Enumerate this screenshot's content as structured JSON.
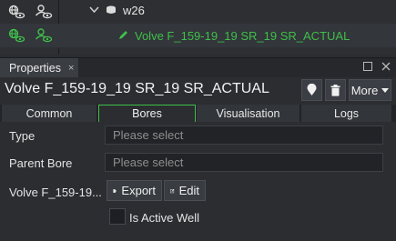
{
  "colors": {
    "accent_green": "#3fbf4a",
    "background": "#2b2d31"
  },
  "tree": {
    "node1": {
      "label": "w26",
      "icon": "database-icon",
      "expander": "chevron-down-icon"
    },
    "node2": {
      "label": "Volve F_159-19_19 SR_19 SR_ACTUAL",
      "icon": "pencil-icon"
    },
    "row_icons": [
      "globe-eye-icon",
      "user-eye-icon"
    ]
  },
  "panel": {
    "tab_label": "Properties",
    "tab_close": "×",
    "title": "Volve F_159-19_19 SR_19 SR_ACTUAL",
    "buttons": {
      "more_label": "More"
    }
  },
  "subtabs": [
    {
      "label": "Common",
      "active": false
    },
    {
      "label": "Bores",
      "active": true
    },
    {
      "label": "Visualisation",
      "active": false
    },
    {
      "label": "Logs",
      "active": false
    }
  ],
  "form": {
    "type_label": "Type",
    "type_placeholder": "Please select",
    "parent_label": "Parent Bore",
    "parent_placeholder": "Please select",
    "bore_label": "Volve F_159-19...",
    "export_label": "Export",
    "edit_label": "Edit",
    "active_label": "Is Active Well",
    "active_checked": false
  }
}
